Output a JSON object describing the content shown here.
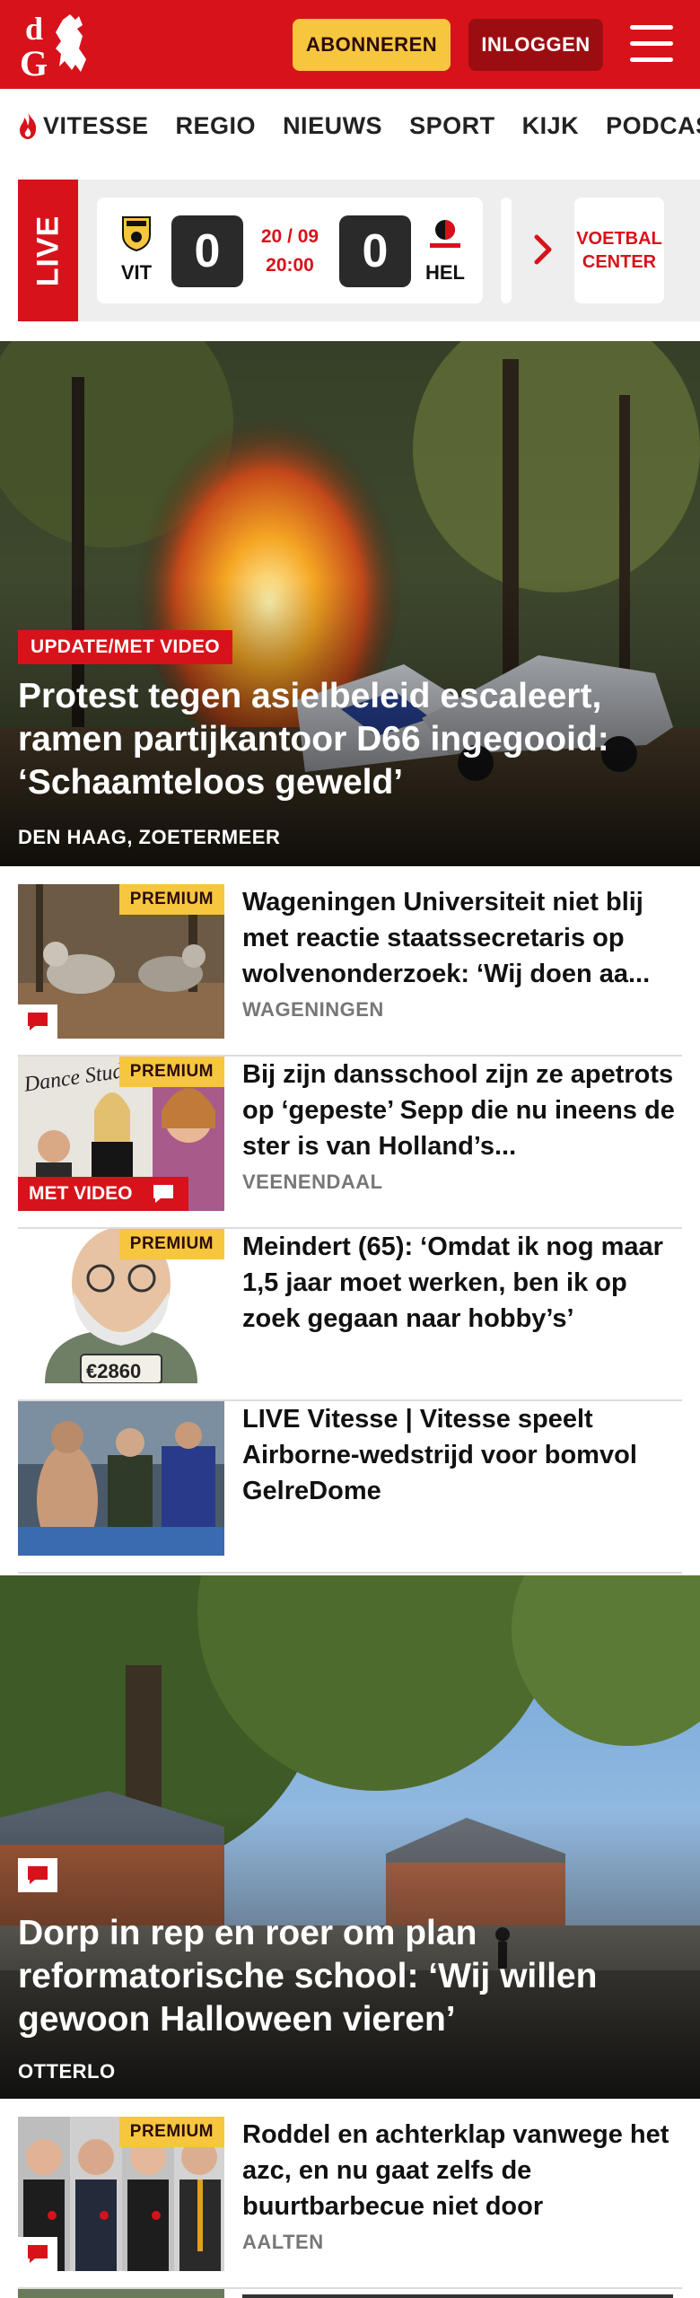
{
  "header": {
    "logo_text": "dG",
    "subscribe_label": "ABONNEREN",
    "login_label": "INLOGGEN",
    "colors": {
      "brand_red": "#d8121b",
      "accent_yellow": "#f6c63e",
      "dark_red": "#9c0d12"
    }
  },
  "nav": {
    "items": [
      "VITESSE",
      "REGIO",
      "NIEUWS",
      "SPORT",
      "KIJK",
      "PODCAST"
    ]
  },
  "live": {
    "label": "LIVE",
    "home_team": "VIT",
    "away_team": "HEL",
    "home_score": "0",
    "away_score": "0",
    "date": "20 / 09",
    "time": "20:00",
    "center_label_1": "VOETBAL",
    "center_label_2": "CENTER"
  },
  "hero1": {
    "tag": "UPDATE/MET VIDEO",
    "title": "Protest tegen asielbeleid escaleert, ramen partijkantoor D66 ingegooid: ‘Schaamteloos geweld’",
    "location": "DEN HAAG, ZOETERMEER"
  },
  "articles": [
    {
      "premium": "PREMIUM",
      "title": "Wageningen Universiteit niet blij met reactie staatssecretaris op wolvenonderzoek: ‘Wij doen aa...",
      "location": "WAGENINGEN",
      "has_comments": true
    },
    {
      "premium": "PREMIUM",
      "title": "Bij zijn dansschool zijn ze apetrots op ‘gepeste’ Sepp die nu ineens de ster is van Holland’s...",
      "location": "VEENENDAAL",
      "video_tag": "MET VIDEO",
      "thumb_text": "Dance Studio Amain",
      "has_comments": true
    },
    {
      "premium": "PREMIUM",
      "title": "Meindert (65): ‘Omdat ik nog maar 1,5 jaar moet werken, ben ik op zoek gegaan naar hobby’s’",
      "location": "",
      "thumb_text": "€2860"
    },
    {
      "premium": "",
      "title": "LIVE Vitesse | Vitesse speelt Airborne-wedstrijd voor bomvol GelreDome",
      "location": ""
    }
  ],
  "hero2": {
    "title": "Dorp in rep en roer om plan reformatorische school: ‘Wij willen gewoon Halloween vieren’",
    "location": "OTTERLO",
    "has_comments": true
  },
  "article_last": {
    "premium": "PREMIUM",
    "title": "Roddel en achterklap vanwege het azc, en nu gaat zelfs de buurtbarbecue niet door",
    "location": "AALTEN",
    "has_comments": true
  }
}
